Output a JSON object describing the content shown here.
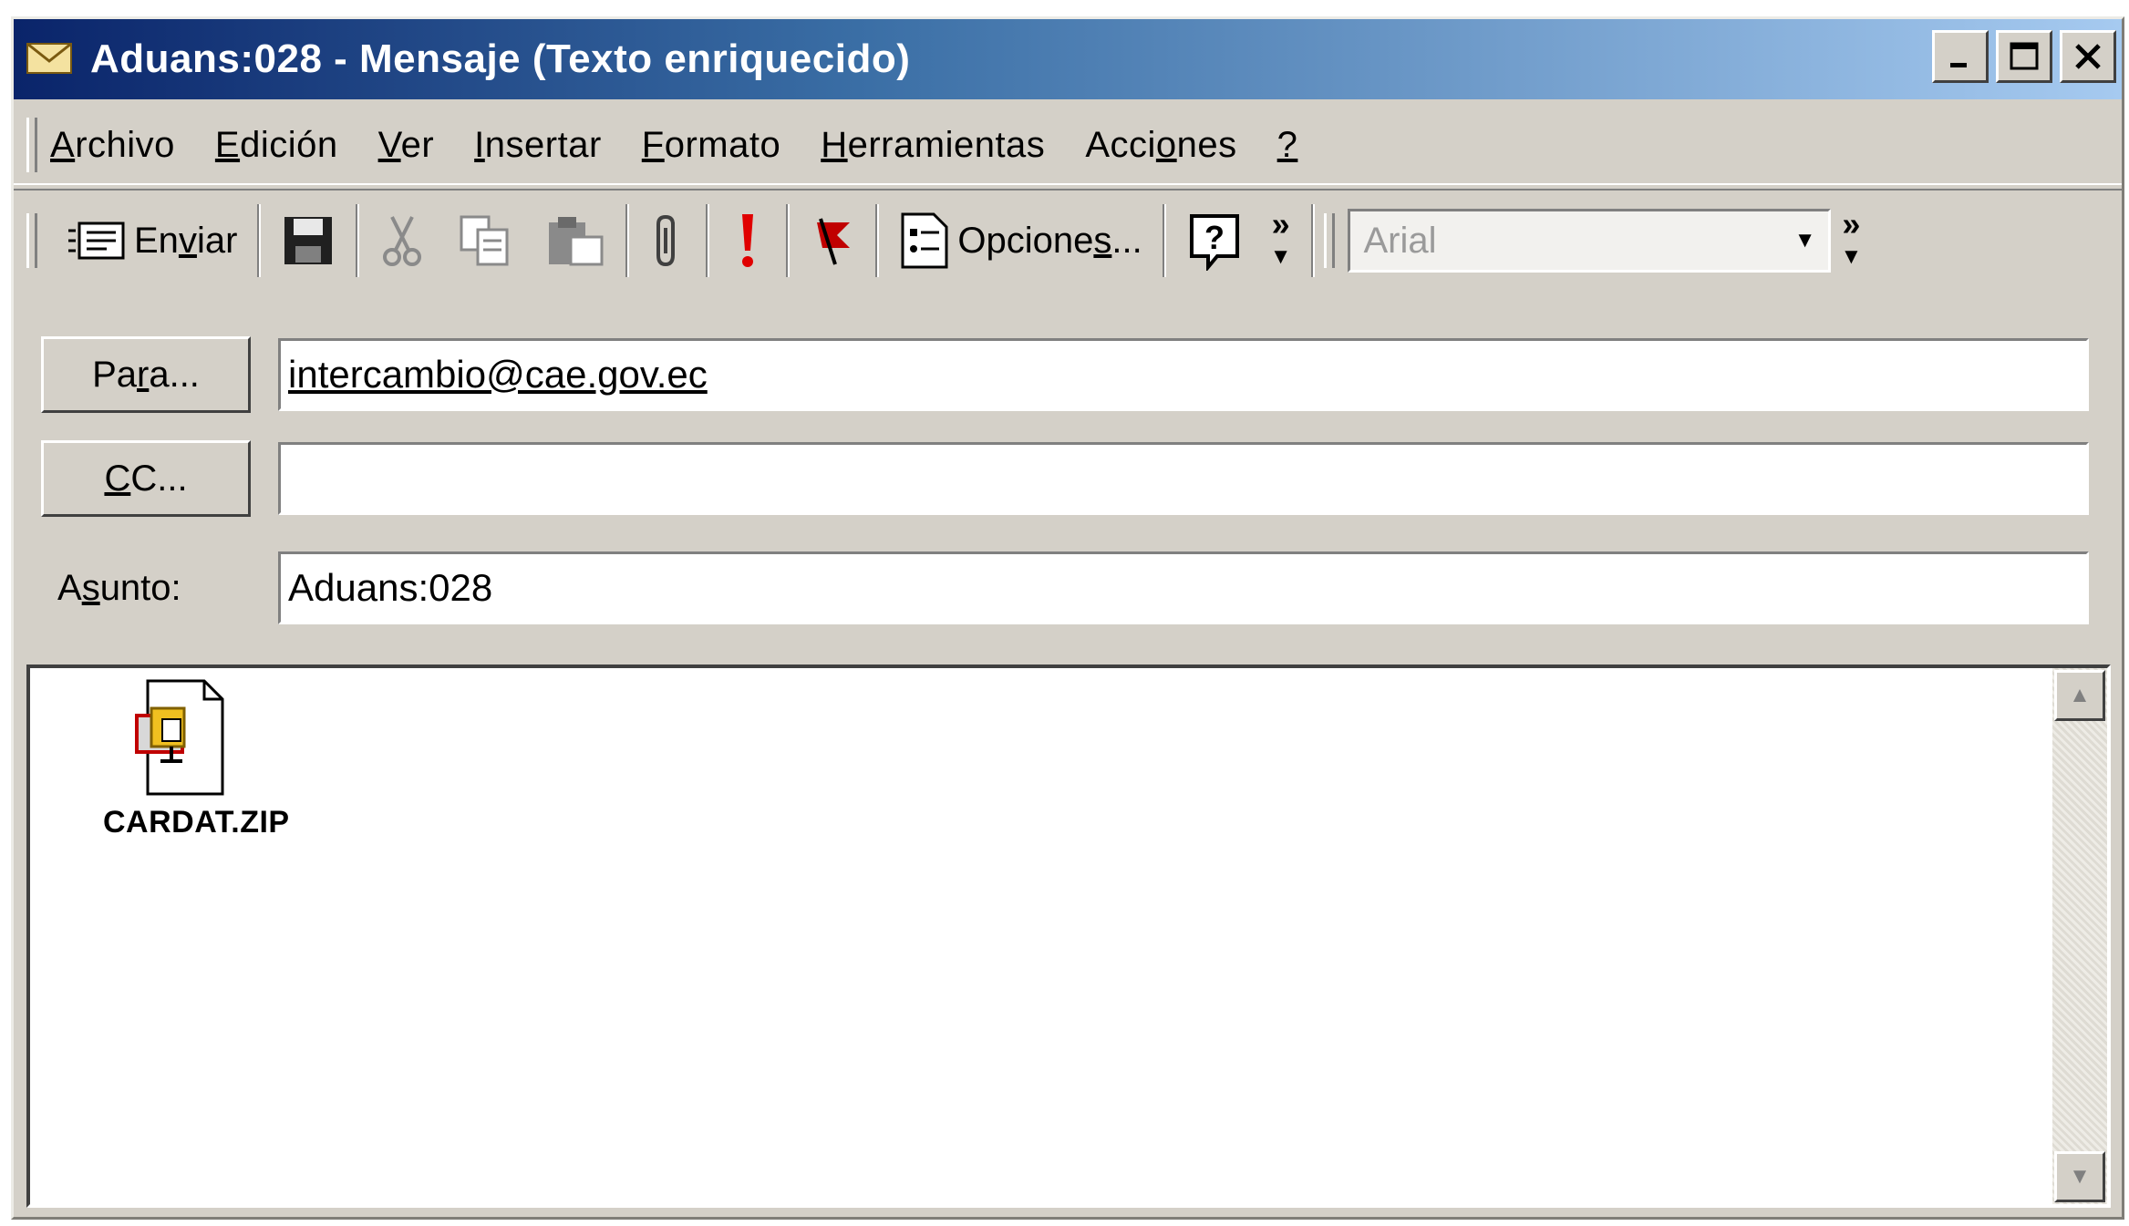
{
  "window": {
    "title": "Aduans:028 - Mensaje (Texto enriquecido)",
    "icon": "envelope-icon",
    "buttons": {
      "minimize": "minimize-icon",
      "maximize": "maximize-icon",
      "close": "close-icon"
    }
  },
  "menu": {
    "items": [
      {
        "pre": "",
        "key": "A",
        "post": "rchivo"
      },
      {
        "pre": "",
        "key": "E",
        "post": "dición"
      },
      {
        "pre": "",
        "key": "V",
        "post": "er"
      },
      {
        "pre": "",
        "key": "I",
        "post": "nsertar"
      },
      {
        "pre": "",
        "key": "F",
        "post": "ormato"
      },
      {
        "pre": "",
        "key": "H",
        "post": "erramientas"
      },
      {
        "pre": "Acci",
        "key": "o",
        "post": "nes"
      },
      {
        "pre": "",
        "key": "?",
        "post": ""
      }
    ]
  },
  "toolbar": {
    "send": {
      "pre": "En",
      "key": "v",
      "post": "iar"
    },
    "options": {
      "pre": "Opcione",
      "key": "s",
      "post": "..."
    },
    "font": "Arial",
    "overflow": "»",
    "icons": [
      "send-icon",
      "save-icon",
      "cut-icon",
      "copy-icon",
      "paste-icon",
      "attach-icon",
      "importance-icon",
      "flag-icon",
      "options-icon",
      "help-icon"
    ]
  },
  "fields": {
    "to": {
      "button_pre": "Pa",
      "button_key": "r",
      "button_post": "a...",
      "value": "intercambio@cae.gov.ec"
    },
    "cc": {
      "button_pre": "",
      "button_key": "C",
      "button_post": "C...",
      "value": ""
    },
    "subject": {
      "label_pre": "A",
      "label_key": "s",
      "label_post": "unto:",
      "value": "Aduans:028"
    }
  },
  "body": {
    "attachment": {
      "name": "CARDAT.ZIP",
      "icon": "zip-file-icon"
    }
  },
  "colors": {
    "titlebar_start": "#0a246a",
    "titlebar_end": "#a6caf0",
    "face": "#d4d0c8",
    "importance": "#e00000",
    "flag": "#c00000"
  }
}
